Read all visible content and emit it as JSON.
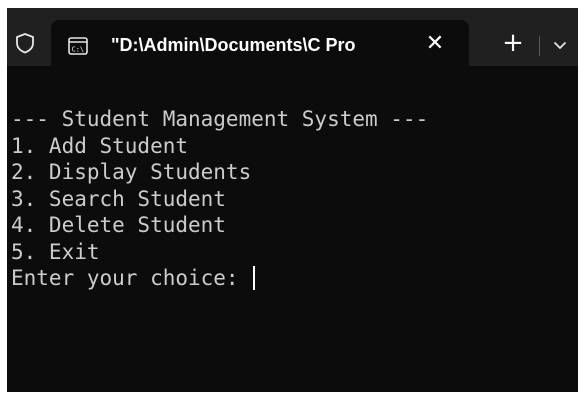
{
  "tab": {
    "title": "\"D:\\Admin\\Documents\\C Pro",
    "icon": "console-icon",
    "close_symbol": "✕"
  },
  "window_controls": {
    "new_tab_symbol": "+",
    "dropdown_icon": "chevron-down-icon",
    "profile_icon": "shield-icon"
  },
  "terminal": {
    "lines": [
      "--- Student Management System ---",
      "1. Add Student",
      "2. Display Students",
      "3. Search Student",
      "4. Delete Student",
      "5. Exit"
    ],
    "prompt": "Enter your choice: "
  },
  "colors": {
    "tabbar_bg": "#202020",
    "terminal_bg": "#0c0c0c",
    "text": "#cccccc"
  }
}
